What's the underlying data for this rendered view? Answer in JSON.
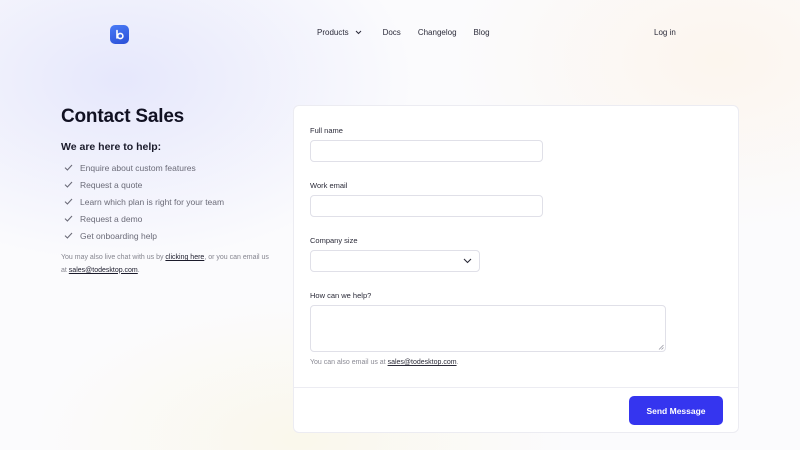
{
  "nav": {
    "items": [
      {
        "label": "Products"
      },
      {
        "label": "Docs"
      },
      {
        "label": "Changelog"
      },
      {
        "label": "Blog"
      }
    ],
    "login_label": "Log in",
    "brand_color": "#3a66ee"
  },
  "intro": {
    "title": "Contact Sales",
    "help_heading": "We are here to help:",
    "help_items": [
      "Enquire about custom features",
      "Request a quote",
      "Learn which plan is right for your team",
      "Request a demo",
      "Get onboarding help"
    ],
    "chat_note_prefix": "You may also live chat with us by ",
    "chat_link": "clicking here",
    "chat_note_middle": ", or you can email us at ",
    "email": "sales@todesktop.com",
    "chat_note_suffix": "."
  },
  "form": {
    "full_name_label": "Full name",
    "full_name_value": "",
    "work_email_label": "Work email",
    "work_email_value": "",
    "company_size_label": "Company size",
    "company_size_value": "",
    "help_label": "How can we help?",
    "help_value": "",
    "email_note_prefix": "You can also email us at ",
    "email": "sales@todesktop.com",
    "email_note_suffix": ".",
    "submit_label": "Send Message",
    "accent_color": "#3535ef"
  }
}
